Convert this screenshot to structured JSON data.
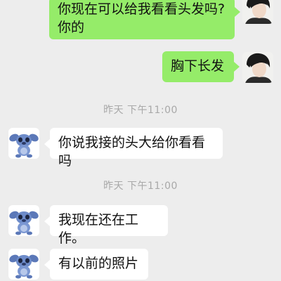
{
  "messages": [
    {
      "side": "right",
      "text_line1": "你现在可以给我看看头发吗?",
      "text_line2": "你的"
    },
    {
      "side": "right",
      "text": "胸下长发"
    },
    {
      "side": "left",
      "text": "你说我接的头大给你看看吗"
    },
    {
      "side": "left",
      "text": "我现在还在工作。"
    },
    {
      "side": "left",
      "text": "有以前的照片"
    }
  ],
  "timestamps": [
    "昨天 下午11:00",
    "昨天 下午11:00"
  ],
  "colors": {
    "background": "#ededed",
    "sent_bubble": "#95ec69",
    "received_bubble": "#ffffff",
    "timestamp_text": "#a8a8a8"
  },
  "icons": {
    "self_avatar": "portrait-avatar-icon",
    "contact_avatar": "stitch-avatar-icon"
  }
}
